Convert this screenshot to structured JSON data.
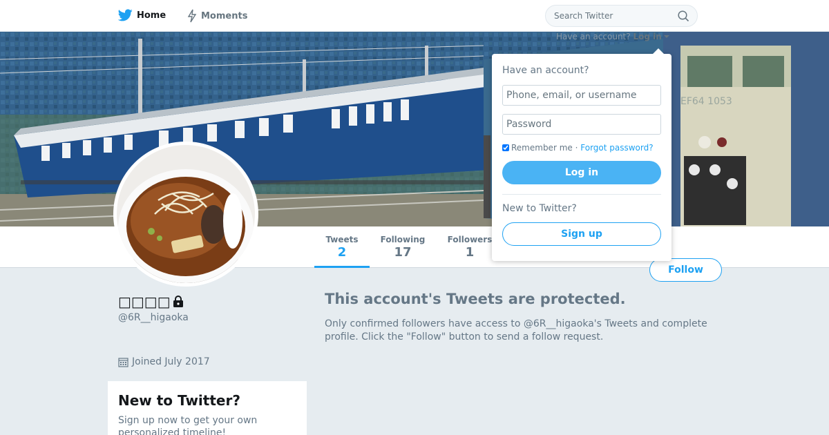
{
  "nav": {
    "home_label": "Home",
    "moments_label": "Moments",
    "search_placeholder": "Search Twitter"
  },
  "login_hint": {
    "prefix": "Have an account?",
    "link": "Log in"
  },
  "login_dropdown": {
    "heading": "Have an account?",
    "username_placeholder": "Phone, email, or username",
    "password_placeholder": "Password",
    "remember_label": "Remember me",
    "separator": "·",
    "forgot_link": "Forgot password?",
    "login_button": "Log in",
    "new_heading": "New to Twitter?",
    "signup_button": "Sign up"
  },
  "stats": {
    "tweets_label": "Tweets",
    "tweets_value": "2",
    "following_label": "Following",
    "following_value": "17",
    "followers_label": "Followers",
    "followers_value": "1"
  },
  "profile": {
    "name": "□□□□",
    "handle": "@6R__higaoka",
    "joined": "Joined July 2017",
    "follow_button": "Follow"
  },
  "protected": {
    "title": "This account's Tweets are protected.",
    "text": "Only confirmed followers have access to @6R__higaoka's Tweets and complete profile. Click the \"Follow\" button to send a follow request."
  },
  "signup_card": {
    "title": "New to Twitter?",
    "text": "Sign up now to get your own personalized timeline!"
  },
  "colors": {
    "accent": "#1da1f2",
    "login_button": "#4ab3f4",
    "background": "#e6ecf0"
  }
}
